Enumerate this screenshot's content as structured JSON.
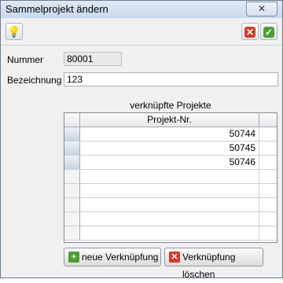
{
  "window": {
    "title": "Sammelprojekt ändern",
    "close_icon": "close-icon"
  },
  "toolbar": {
    "hint_icon": "lightbulb-icon",
    "cancel_icon": "cancel-x-icon",
    "ok_icon": "checkmark-icon"
  },
  "form": {
    "nummer_label": "Nummer",
    "nummer_value": "80001",
    "bezeichnung_label": "Bezeichnung",
    "bezeichnung_value": "123"
  },
  "grid": {
    "caption": "verknüpfte Projekte",
    "column_header": "Projekt-Nr.",
    "rows": [
      "50744",
      "50745",
      "50746",
      "",
      "",
      "",
      "",
      ""
    ]
  },
  "buttons": {
    "new_label": "neue Verknüpfung",
    "delete_label": "Verknüpfung löschen"
  }
}
